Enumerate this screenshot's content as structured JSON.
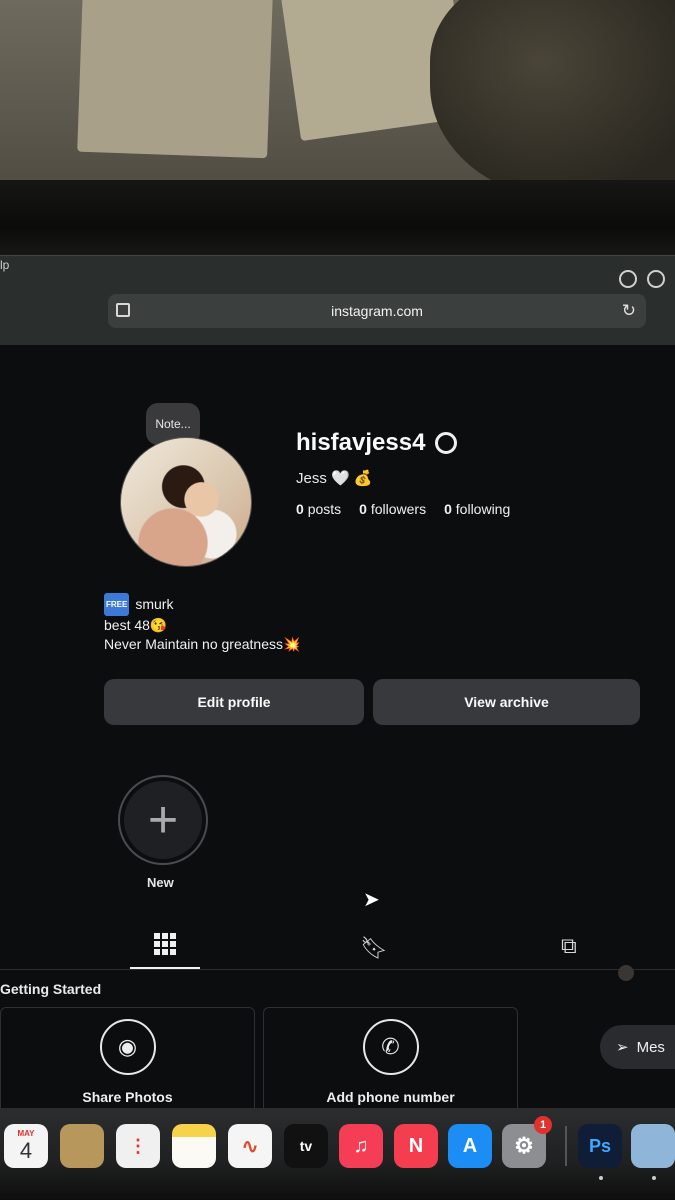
{
  "browser": {
    "menu_fragment": "lp",
    "url": "instagram.com"
  },
  "profile": {
    "note": "Note...",
    "username": "hisfavjess4",
    "display_name": "Jess 🤍 💰",
    "stats": {
      "posts_count": "0",
      "posts_label": "posts",
      "followers_count": "0",
      "followers_label": "followers",
      "following_count": "0",
      "following_label": "following"
    },
    "bio": {
      "line1_badge": "FREE",
      "line1_text": "smurk",
      "line2": "best 48😘",
      "line3": "Never Maintain no greatness💥"
    },
    "buttons": {
      "edit": "Edit profile",
      "archive": "View archive"
    },
    "highlight_new_label": "New"
  },
  "tabs": {
    "active": "posts"
  },
  "getting_started": {
    "title": "Getting Started",
    "cards": [
      {
        "label": "Share Photos",
        "icon": "camera-icon"
      },
      {
        "label": "Add phone number",
        "icon": "phone-icon"
      }
    ]
  },
  "messages": {
    "label": "Mes"
  },
  "dock": {
    "calendar_month": "MAY",
    "calendar_day": "4",
    "tv_label": "tv",
    "settings_badge": "1",
    "ps_label": "Ps"
  },
  "colors": {
    "page_bg": "#0c0d0f",
    "button_bg": "#38393d",
    "badge_red": "#e0312e",
    "free_badge_blue": "#3d79d6"
  }
}
